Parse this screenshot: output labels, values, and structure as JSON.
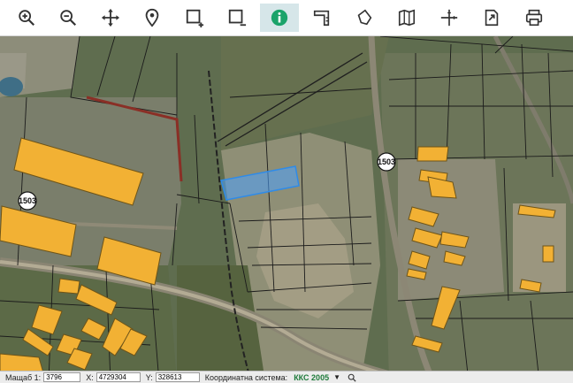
{
  "toolbar": {
    "tools": [
      {
        "name": "zoom-in-tool",
        "icon": "zoom-in-icon"
      },
      {
        "name": "zoom-out-tool",
        "icon": "zoom-out-icon"
      },
      {
        "name": "pan-tool",
        "icon": "move-arrows-icon"
      },
      {
        "name": "location-tool",
        "icon": "location-pin-icon"
      },
      {
        "name": "select-add-tool",
        "icon": "rectangle-plus-icon"
      },
      {
        "name": "select-remove-tool",
        "icon": "rectangle-minus-icon"
      },
      {
        "name": "info-tool",
        "icon": "info-circle-icon",
        "active": true
      },
      {
        "name": "measure-distance-tool",
        "icon": "ruler-corner-icon"
      },
      {
        "name": "measure-area-tool",
        "icon": "polygon-icon"
      },
      {
        "name": "map-tool",
        "icon": "folded-map-icon"
      },
      {
        "name": "coordinate-tool",
        "icon": "crosshair-icon"
      },
      {
        "name": "export-tool",
        "icon": "document-arrow-icon"
      },
      {
        "name": "print-tool",
        "icon": "printer-icon"
      }
    ],
    "active_color": "#1aa36a"
  },
  "map": {
    "road_labels": [
      "1503",
      "1503"
    ],
    "highlight_color": "#4da3ff",
    "building_color": "#f2b134"
  },
  "statusbar": {
    "scale_label": "Мащаб 1:",
    "scale_value": "3796",
    "x_label": "X:",
    "x_value": "4729304",
    "y_label": "Y:",
    "y_value": "328613",
    "coord_system_label": "Координатна система:",
    "coord_system_value": "ККС 2005",
    "dropdown_icon": "caret-down-icon",
    "search_icon": "search-icon"
  }
}
